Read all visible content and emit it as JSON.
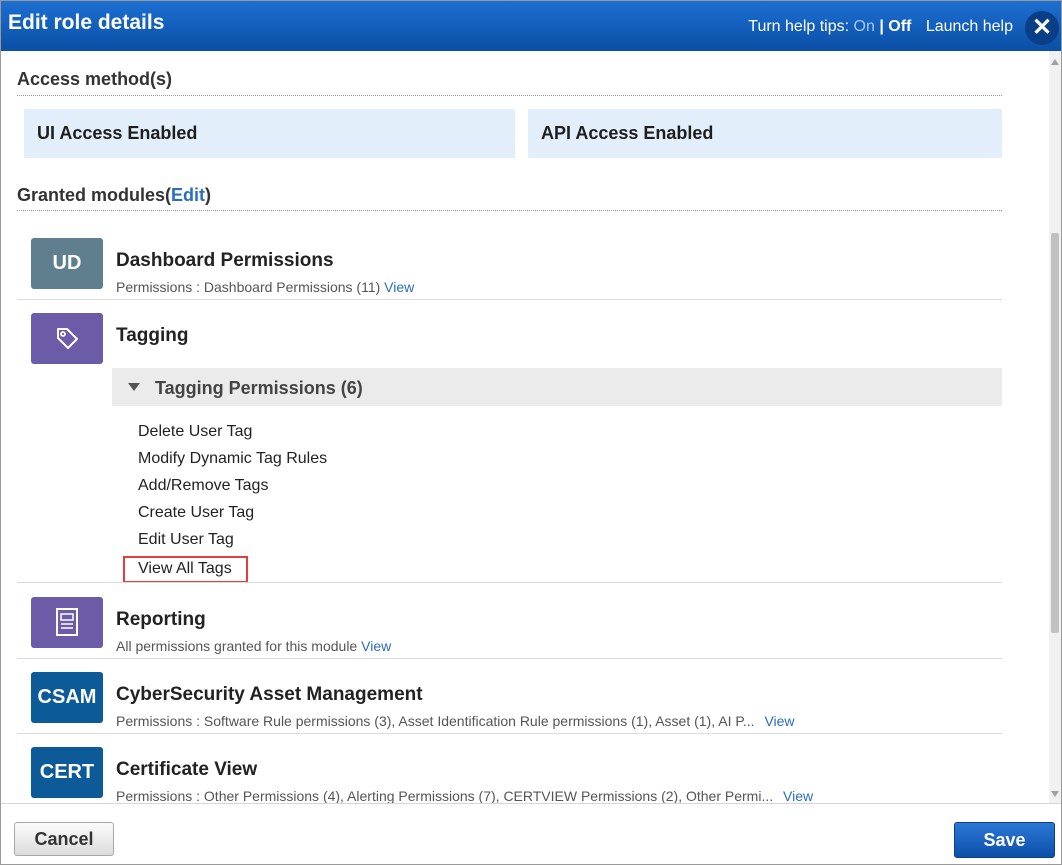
{
  "header": {
    "title": "Edit role details",
    "help_tips_label": "Turn help tips:",
    "help_on": "On",
    "help_sep": "|",
    "help_off": "Off",
    "launch_help": "Launch help",
    "close_icon": "close-icon"
  },
  "access": {
    "title": "Access method(s)",
    "ui": "UI Access Enabled",
    "api": "API Access Enabled"
  },
  "granted": {
    "title": "Granted modules(",
    "edit": "Edit",
    "close_paren": ")"
  },
  "modules": [
    {
      "abbr": "UD",
      "name": "Dashboard Permissions",
      "sub": "Permissions : Dashboard Permissions (11)",
      "view": "View",
      "color": "#5f7f8f"
    },
    {
      "icon": "tag-icon",
      "name": "Tagging",
      "color": "#6c5ba6",
      "permissions_header": "Tagging Permissions (6)",
      "permissions": [
        "Delete User Tag",
        "Modify Dynamic Tag Rules",
        "Add/Remove Tags",
        "Create User Tag",
        "Edit User Tag",
        "View All Tags"
      ]
    },
    {
      "icon": "report-icon",
      "name": "Reporting",
      "sub": "All permissions granted for this module",
      "view": "View",
      "color": "#6c5ba6"
    },
    {
      "abbr": "CSAM",
      "name": "CyberSecurity Asset Management",
      "sub": "Permissions : Software Rule permissions (3), Asset Identification Rule permissions (1), Asset (1), AI P...",
      "view": "View",
      "color": "#0c5a98"
    },
    {
      "abbr": "CERT",
      "name": "Certificate View",
      "sub": "Permissions : Other Permissions (4), Alerting Permissions (7), CERTVIEW Permissions (2), Other Permi...",
      "view": "View",
      "color": "#0c5a98"
    }
  ],
  "footer": {
    "cancel": "Cancel",
    "save": "Save"
  }
}
